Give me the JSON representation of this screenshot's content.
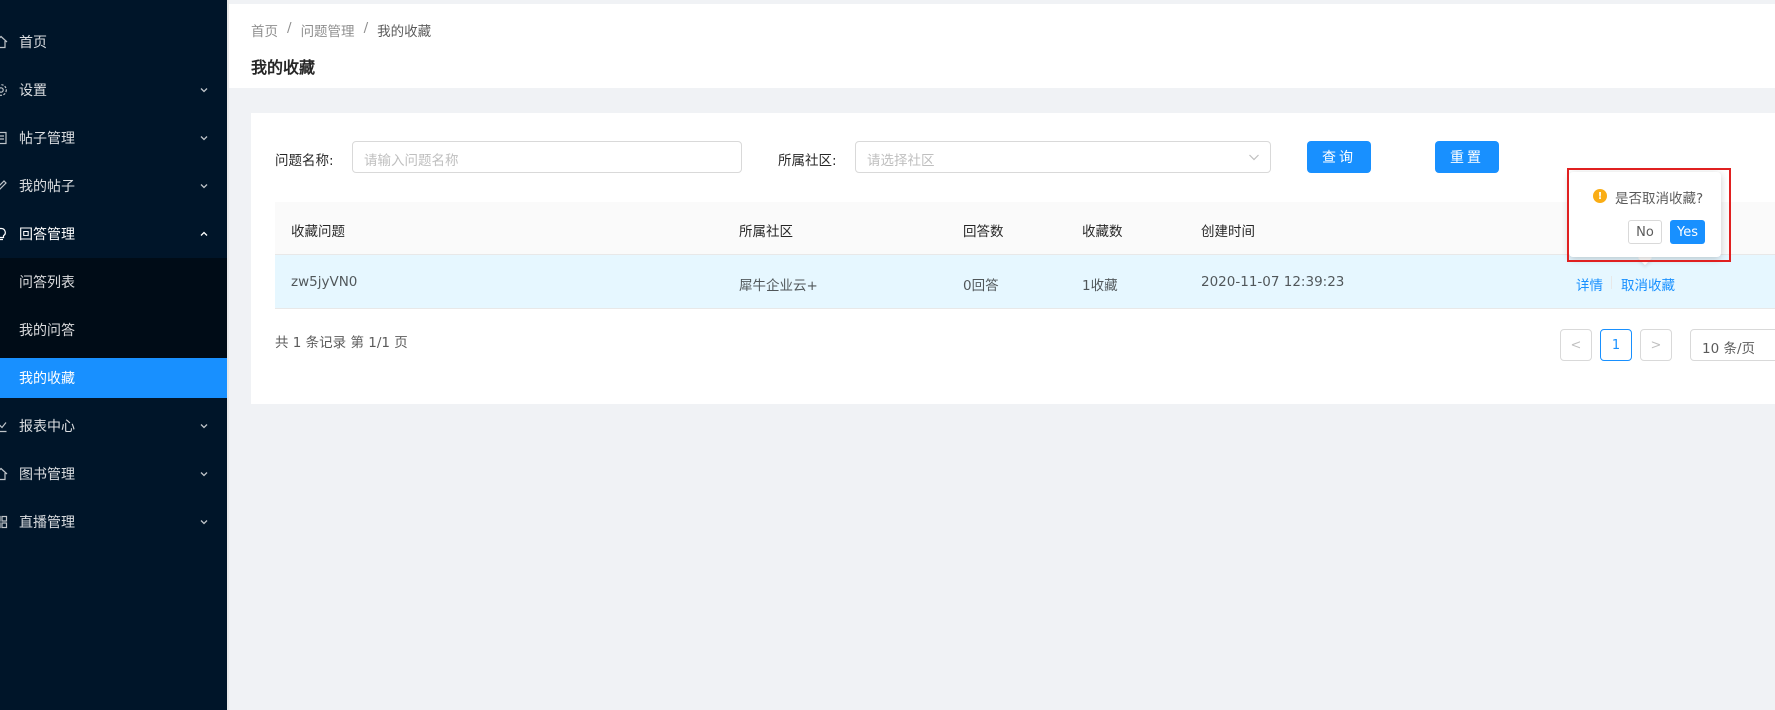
{
  "sidebar": {
    "items": [
      {
        "label": "首页",
        "icon": "home-icon"
      },
      {
        "label": "设置",
        "icon": "gear-icon"
      },
      {
        "label": "帖子管理",
        "icon": "document-icon"
      },
      {
        "label": "我的帖子",
        "icon": "edit-icon"
      },
      {
        "label": "回答管理",
        "icon": "bulb-icon"
      },
      {
        "label": "问答列表"
      },
      {
        "label": "我的问答"
      },
      {
        "label": "我的收藏"
      },
      {
        "label": "报表中心",
        "icon": "chart-icon"
      },
      {
        "label": "图书管理",
        "icon": "home-icon"
      },
      {
        "label": "直播管理",
        "icon": "grid-icon"
      }
    ]
  },
  "breadcrumb": [
    "首页",
    "问题管理",
    "我的收藏"
  ],
  "breadcrumb_sep": "/",
  "page_title": "我的收藏",
  "form": {
    "question_label": "问题名称:",
    "question_placeholder": "请输入问题名称",
    "community_label": "所属社区:",
    "community_placeholder": "请选择社区",
    "search_button": "查询",
    "reset_button": "重置"
  },
  "table": {
    "columns": [
      "收藏问题",
      "所属社区",
      "回答数",
      "收藏数",
      "创建时间"
    ],
    "rows": [
      {
        "question": "zw5jyVN0",
        "community": "犀牛企业云+",
        "answers": "0回答",
        "favorites": "1收藏",
        "created": "2020-11-07 12:39:23",
        "detail": "详情",
        "cancel": "取消收藏"
      }
    ]
  },
  "pagination": {
    "summary": "共 1 条记录 第 1/1 页",
    "current_page": "1",
    "prev": "<",
    "next": ">",
    "page_size": "10 条/页"
  },
  "popconfirm": {
    "icon": "!",
    "message": "是否取消收藏?",
    "no": "No",
    "yes": "Yes"
  },
  "colors": {
    "sidebar_bg": "#001529",
    "primary": "#1890ff",
    "warning": "#faad14",
    "highlight": "#e02020"
  }
}
